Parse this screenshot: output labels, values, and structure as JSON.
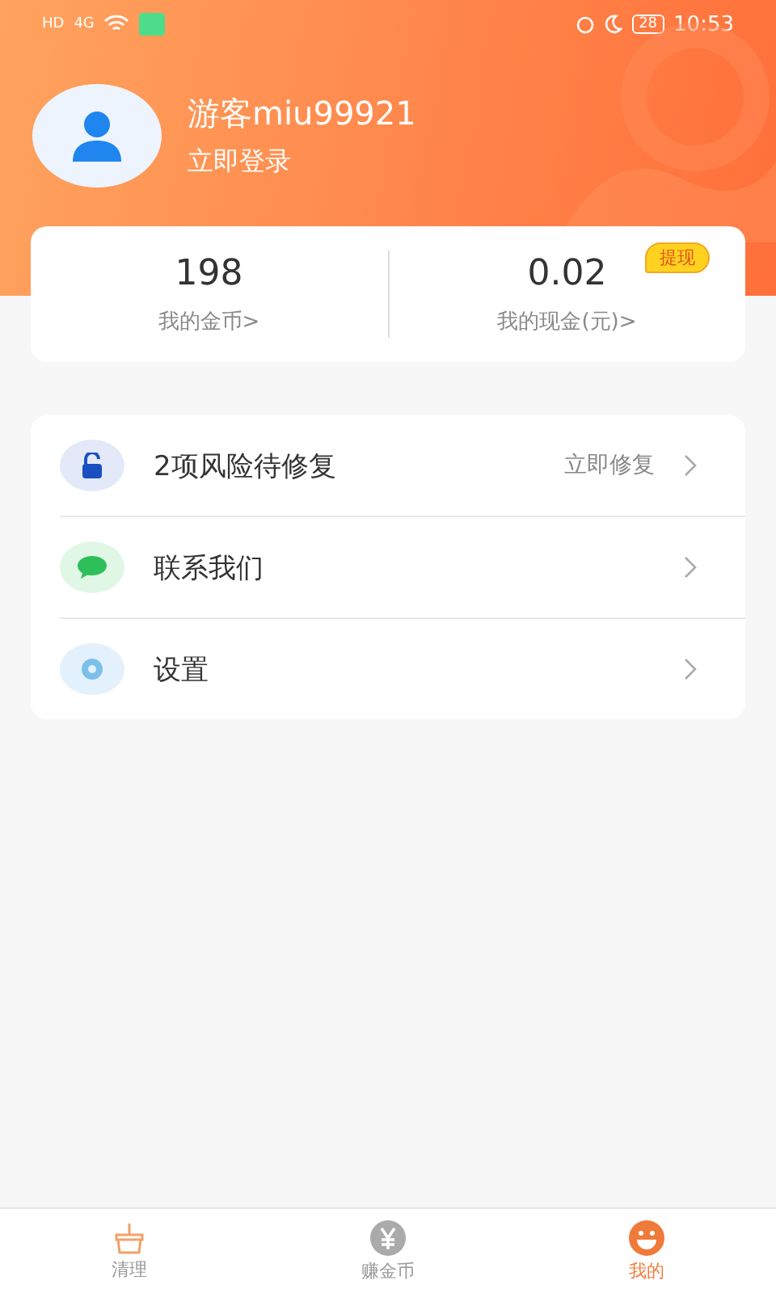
{
  "status_bar": {
    "left": [
      "HD",
      "4G"
    ],
    "battery": "28",
    "time": "10:53"
  },
  "profile": {
    "name": "游客miu99921",
    "login": "立即登录"
  },
  "wallet": [
    {
      "value": "198",
      "label": "我的金币>"
    },
    {
      "value": "0.02",
      "label": "我的现金(元)>",
      "badge": "提现"
    }
  ],
  "menu": [
    {
      "kind": "lock",
      "title": "2项风险待修复",
      "action": "立即修复"
    },
    {
      "kind": "chat",
      "title": "联系我们"
    },
    {
      "kind": "gear",
      "title": "设置"
    }
  ],
  "tabs": [
    {
      "kind": "basket",
      "label": "清理",
      "selected": false
    },
    {
      "kind": "coin",
      "label": "赚金币",
      "selected": false
    },
    {
      "kind": "smile",
      "label": "我的",
      "selected": true
    }
  ]
}
